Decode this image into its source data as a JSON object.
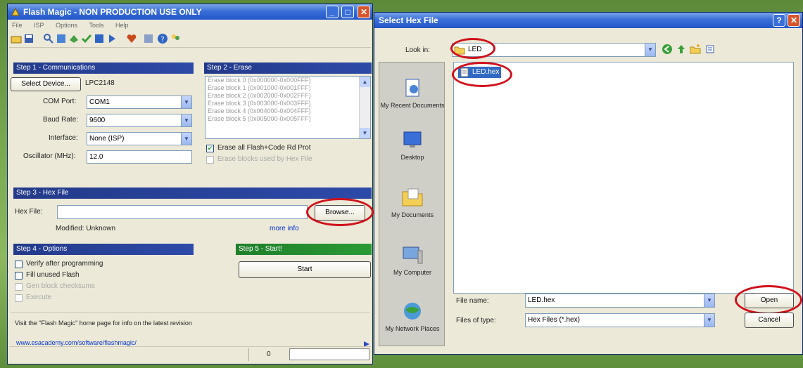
{
  "flash_magic": {
    "title": "Flash Magic - NON PRODUCTION USE ONLY",
    "menu": [
      "File",
      "ISP",
      "Options",
      "Tools",
      "Help"
    ],
    "step1": {
      "header": "Step 1 - Communications",
      "select_device_label": "Select Device...",
      "device_value": "LPC2148",
      "com_port_label": "COM Port:",
      "com_port_value": "COM1",
      "baud_rate_label": "Baud Rate:",
      "baud_rate_value": "9600",
      "interface_label": "Interface:",
      "interface_value": "None (ISP)",
      "oscillator_label": "Oscillator (MHz):",
      "oscillator_value": "12.0"
    },
    "step2": {
      "header": "Step 2 - Erase",
      "erase_rows": [
        "Erase block 0 (0x000000-0x000FFF)",
        "Erase block 1 (0x001000-0x001FFF)",
        "Erase block 2 (0x002000-0x002FFF)",
        "Erase block 3 (0x003000-0x003FFF)",
        "Erase block 4 (0x004000-0x004FFF)",
        "Erase block 5 (0x005000-0x005FFF)"
      ],
      "erase_all_label": "Erase all Flash+Code Rd Prot",
      "erase_used_label": "Erase blocks used by Hex File"
    },
    "step3": {
      "header": "Step 3 - Hex File",
      "hex_file_label": "Hex File:",
      "hex_file_value": "",
      "browse_label": "Browse...",
      "modified_label": "Modified: Unknown",
      "more_info_label": "more info"
    },
    "step4": {
      "header": "Step 4 - Options",
      "verify_label": "Verify after programming",
      "fill_label": "Fill unused Flash",
      "gen_checksum_label": "Gen block checksums",
      "execute_label": "Execute"
    },
    "step5": {
      "header": "Step 5 - Start!",
      "start_label": "Start"
    },
    "info_line": "Visit the \"Flash Magic\" home page for info on the latest revision",
    "bottom_link": "www.esacademy.com/software/flashmagic/",
    "status_value": "0"
  },
  "dialog": {
    "title": "Select Hex File",
    "look_in_label": "Look in:",
    "look_in_value": "LED",
    "places": [
      "My Recent Documents",
      "Desktop",
      "My Documents",
      "My Computer",
      "My Network Places"
    ],
    "files": [
      "LED.hex"
    ],
    "file_name_label": "File name:",
    "file_name_value": "LED.hex",
    "file_type_label": "Files of type:",
    "file_type_value": "Hex Files (*.hex)",
    "open_label": "Open",
    "cancel_label": "Cancel"
  },
  "colors": {
    "title_blue": "#2456c8",
    "section_blue": "#233a8a",
    "section_green": "#1f7f2a",
    "highlight_red": "#d0101a",
    "selection_blue": "#316ac5"
  }
}
